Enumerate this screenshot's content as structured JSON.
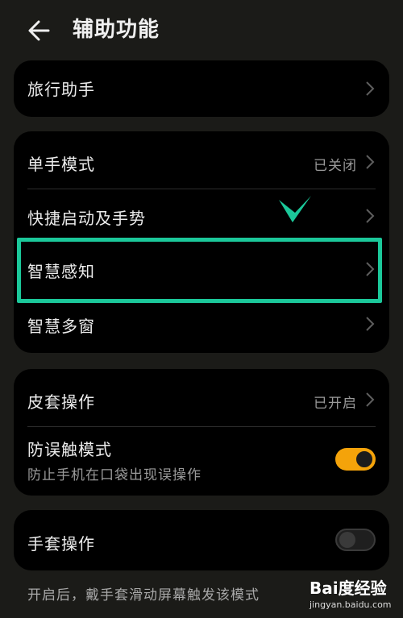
{
  "header": {
    "title": "辅助功能"
  },
  "group1": {
    "items": [
      {
        "label": "旅行助手"
      }
    ]
  },
  "group2": {
    "items": [
      {
        "label": "单手模式",
        "value": "已关闭"
      },
      {
        "label": "快捷启动及手势"
      },
      {
        "label": "智慧感知"
      },
      {
        "label": "智慧多窗"
      }
    ]
  },
  "group3": {
    "items": [
      {
        "label": "皮套操作",
        "value": "已开启"
      },
      {
        "label": "防误触模式",
        "sub": "防止手机在口袋出现误操作",
        "toggle": true
      }
    ]
  },
  "group4": {
    "items": [
      {
        "label": "手套操作",
        "toggle": false
      }
    ],
    "footnote": "开启后，戴手套滑动屏幕触发该模式"
  },
  "annotation": {
    "highlight_color": "#1bc89a",
    "highlighted_item": "智慧感知"
  },
  "colors": {
    "accent": "#f4a30a",
    "background": "#1b1b18",
    "card": "#000000"
  },
  "watermark": {
    "text": "Bai度经验",
    "url": "jingyan.baidu.com"
  }
}
